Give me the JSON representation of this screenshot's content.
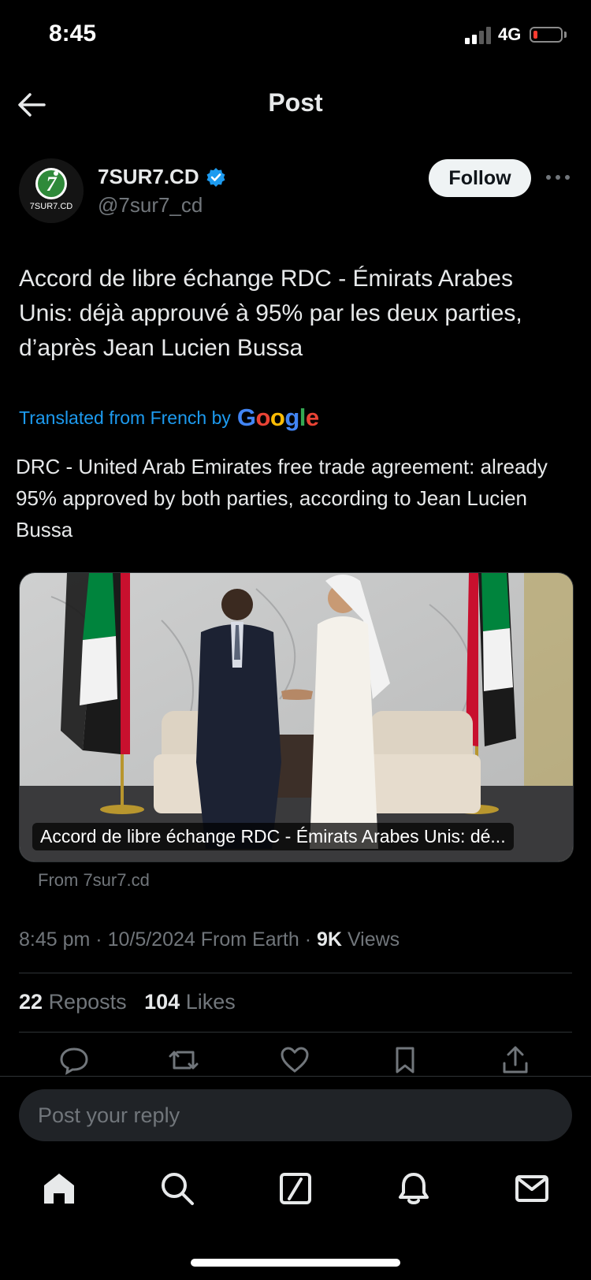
{
  "status_bar": {
    "time": "8:45",
    "network": "4G"
  },
  "header": {
    "title": "Post"
  },
  "author": {
    "name": "7SUR7.CD",
    "handle": "@7sur7_cd",
    "avatar_text": "7SUR7.CD",
    "follow_label": "Follow",
    "verified": true
  },
  "post": {
    "text": "Accord de libre échange RDC - Émirats Arabes Unis: déjà approuvé à 95% par les deux parties, d’après Jean Lucien Bussa",
    "translated_prefix": "Translated from French by",
    "translated_brand": "Google",
    "translation": "DRC - United Arab Emirates free trade agreement: already 95% approved by both parties, according to Jean Lucien Bussa",
    "card_caption": "Accord de libre échange RDC - Émirats Arabes Unis: dé...",
    "card_source": "From 7sur7.cd",
    "time": "8:45 pm",
    "date": "10/5/2024",
    "location": "From Earth",
    "views_count": "9K",
    "views_label": "Views",
    "reposts_count": "22",
    "reposts_label": "Reposts",
    "likes_count": "104",
    "likes_label": "Likes"
  },
  "reply": {
    "placeholder": "Post your reply"
  },
  "colors": {
    "accent": "#1d9bf0",
    "muted": "#71767b",
    "text": "#e7e9ea",
    "background": "#000000"
  },
  "icons": {
    "actions": [
      "reply-icon",
      "repost-icon",
      "like-icon",
      "bookmark-icon",
      "share-icon"
    ],
    "nav": [
      "home-icon",
      "search-icon",
      "grok-icon",
      "notifications-icon",
      "messages-icon"
    ]
  }
}
